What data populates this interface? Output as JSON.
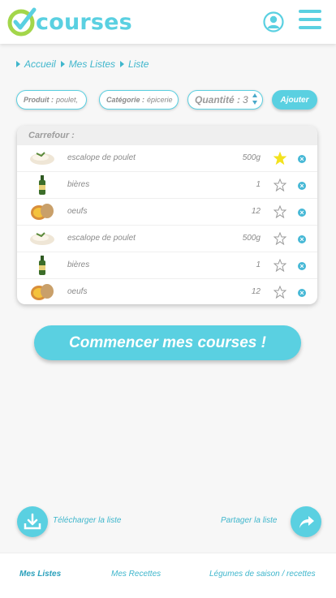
{
  "header": {
    "logo_text": "courses",
    "icons": [
      "user-icon",
      "hamburger-menu-icon"
    ]
  },
  "breadcrumb": [
    {
      "label": "Accueil"
    },
    {
      "label": "Mes Listes"
    },
    {
      "label": "Liste"
    }
  ],
  "filters": {
    "produit": {
      "label": "Produit :",
      "value": "poulet,"
    },
    "categorie": {
      "label": "Catégorie :",
      "value": "épicerie"
    },
    "quantite": {
      "label": "Quantité :",
      "value": "3"
    },
    "add_label": "Ajouter"
  },
  "list": {
    "store": "Carrefour :",
    "items": [
      {
        "name": "escalope de poulet",
        "qty": "500g",
        "favorite": true,
        "icon": "chicken-icon"
      },
      {
        "name": "bières",
        "qty": "1",
        "favorite": false,
        "icon": "beer-bottle-icon"
      },
      {
        "name": "oeufs",
        "qty": "12",
        "favorite": false,
        "icon": "eggs-icon"
      },
      {
        "name": "escalope de poulet",
        "qty": "500g",
        "favorite": false,
        "icon": "chicken-icon"
      },
      {
        "name": "bières",
        "qty": "1",
        "favorite": false,
        "icon": "beer-bottle-icon"
      },
      {
        "name": "oeufs",
        "qty": "12",
        "favorite": false,
        "icon": "eggs-icon"
      }
    ]
  },
  "start_button": "Commencer mes courses !",
  "actions": {
    "download": "Télécharger la liste",
    "share": "Partager la liste"
  },
  "bottom_nav": [
    {
      "label": "Mes Listes",
      "active": true
    },
    {
      "label": "Mes Recettes",
      "active": false
    },
    {
      "label": "Légumes de saison / recettes",
      "active": false
    }
  ],
  "colors": {
    "accent": "#5ad0e1",
    "link": "#3fb6cc",
    "star_active": "#f3e21e"
  }
}
